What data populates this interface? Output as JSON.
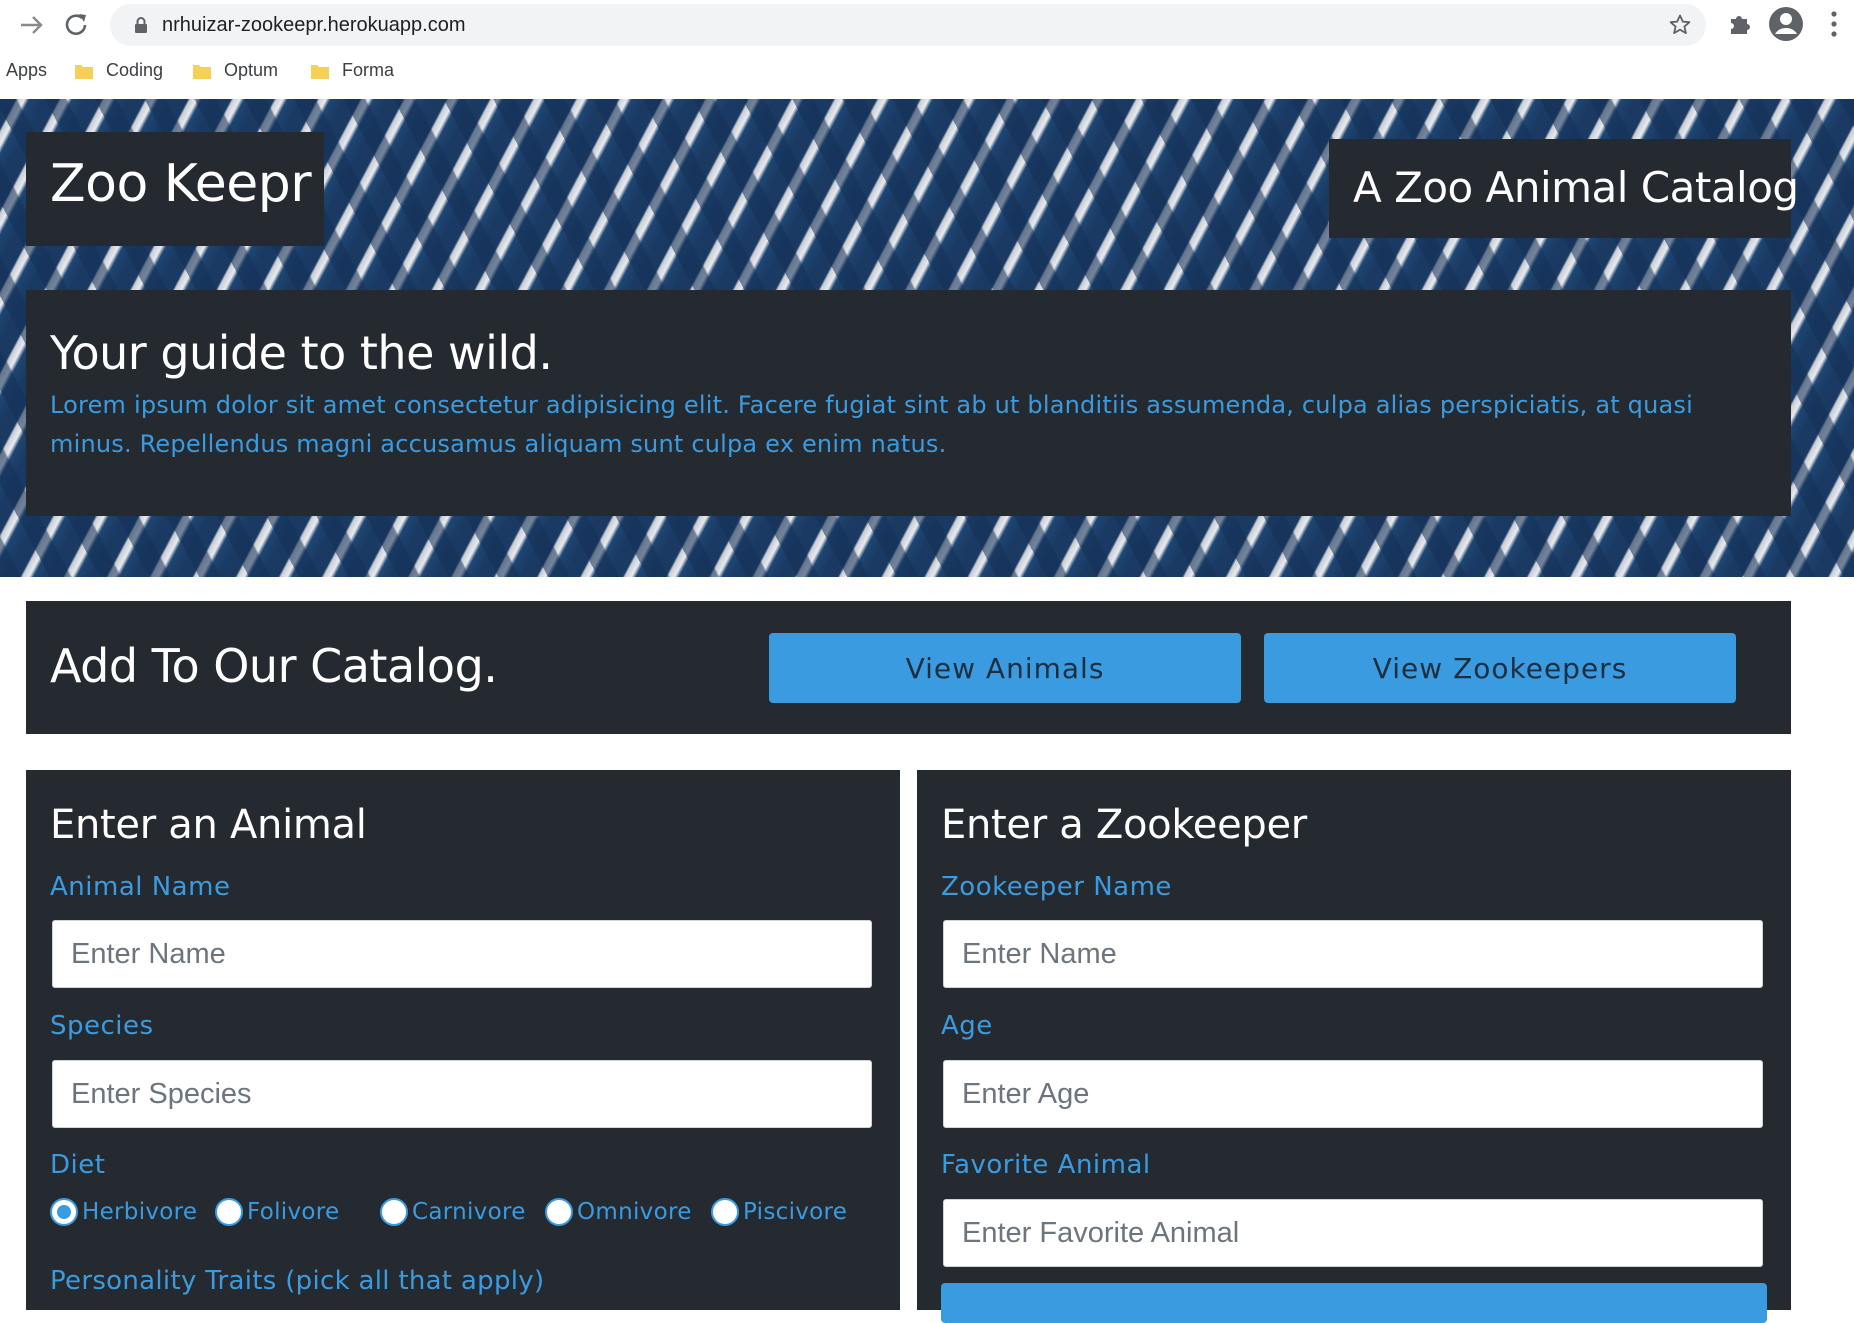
{
  "browser": {
    "url": "nrhuizar-zookeepr.herokuapp.com",
    "bookmarks": [
      "Apps",
      "Coding",
      "Optum",
      "Forma"
    ]
  },
  "header": {
    "brand": "Zoo Keepr",
    "tagline": "A Zoo Animal Catalog"
  },
  "intro": {
    "heading": "Your guide to the wild.",
    "text": "Lorem ipsum dolor sit amet consectetur adipisicing elit. Facere fugiat sint ab ut blanditiis assumenda, culpa alias perspiciatis, at quasi minus. Repellendus magni accusamus aliquam sunt culpa ex enim natus."
  },
  "catalog": {
    "title": "Add To Our Catalog.",
    "view_animals": "View Animals",
    "view_zookeepers": "View Zookeepers"
  },
  "animal_form": {
    "title": "Enter an Animal",
    "name_label": "Animal Name",
    "name_placeholder": "Enter Name",
    "species_label": "Species",
    "species_placeholder": "Enter Species",
    "diet_label": "Diet",
    "diet_options": [
      "Herbivore",
      "Folivore",
      "Carnivore",
      "Omnivore",
      "Piscivore"
    ],
    "diet_selected": "Herbivore",
    "traits_label": "Personality Traits (pick all that apply)"
  },
  "zookeeper_form": {
    "title": "Enter a Zookeeper",
    "name_label": "Zookeeper Name",
    "name_placeholder": "Enter Name",
    "age_label": "Age",
    "age_placeholder": "Enter Age",
    "favorite_label": "Favorite Animal",
    "favorite_placeholder": "Enter Favorite Animal"
  },
  "colors": {
    "panel": "#252a30",
    "accent": "#3b9be0",
    "hero_stripe_dark": "#1a3a63",
    "hero_stripe_light": "#e8eaee"
  }
}
